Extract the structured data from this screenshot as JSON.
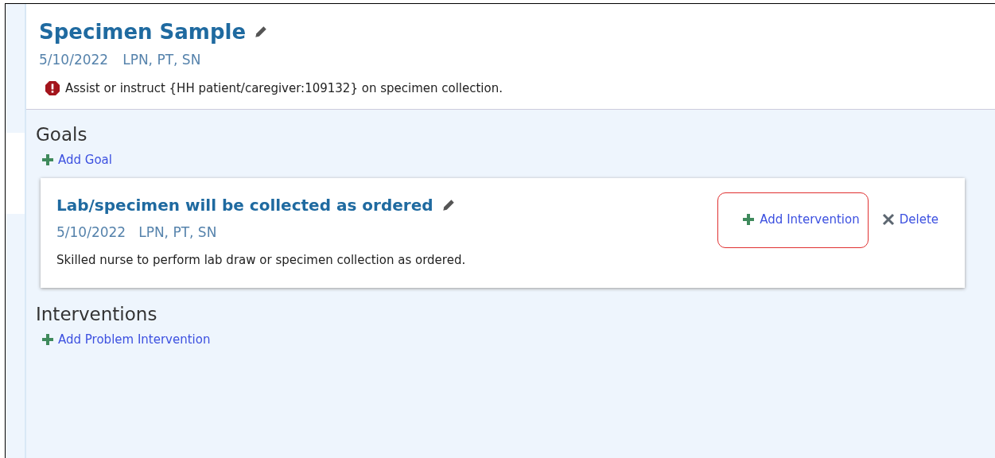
{
  "problem": {
    "title": "Specimen Sample",
    "date": "5/10/2022",
    "disciplines": "LPN, PT, SN",
    "alert": "Assist or instruct {HH patient/caregiver:109132} on specimen collection."
  },
  "goals_section": {
    "heading": "Goals",
    "add_link": "Add Goal"
  },
  "goals": [
    {
      "title": "Lab/specimen will be collected as ordered",
      "date": "5/10/2022",
      "disciplines": "LPN, PT, SN",
      "description": "Skilled nurse to perform lab draw or specimen collection as ordered.",
      "actions": [
        {
          "kind": "add",
          "label": "Add Intervention",
          "highlighted": true
        },
        {
          "kind": "delete",
          "label": "Delete",
          "highlighted": false
        }
      ]
    }
  ],
  "interventions_section": {
    "heading": "Interventions",
    "add_link": "Add Problem Intervention"
  }
}
